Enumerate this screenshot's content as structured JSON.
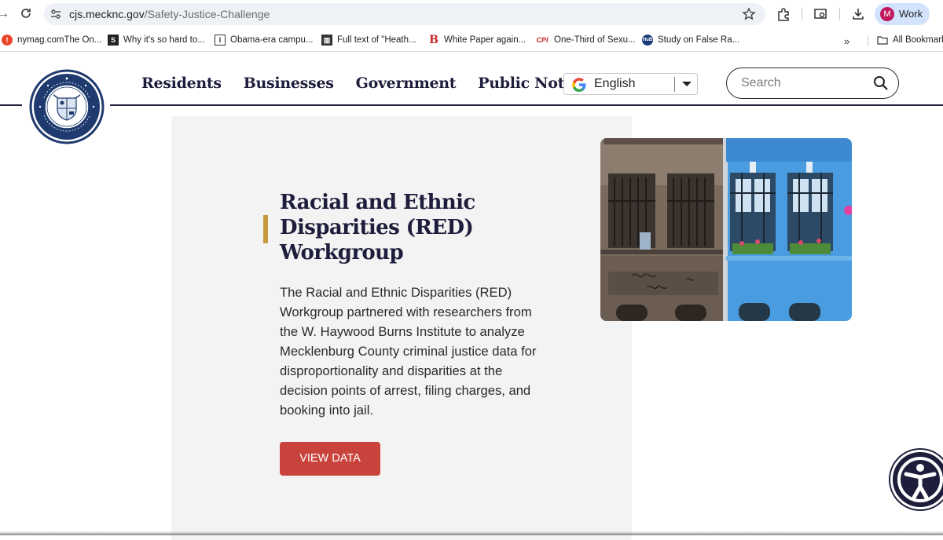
{
  "browser": {
    "url_host": "cjs.mecknc.gov",
    "url_path": "/Safety-Justice-Challenge",
    "profile_initial": "M",
    "profile_name": "Work",
    "bookmarks": [
      {
        "label": "nymag.comThe On...",
        "icon": "nymag-icon"
      },
      {
        "label": "Why it's so hard to...",
        "icon": "slate-icon"
      },
      {
        "label": "Obama-era campu...",
        "icon": "bookmark-site-icon"
      },
      {
        "label": "Full text of \"Heath...",
        "icon": "archive-icon"
      },
      {
        "label": "White Paper again...",
        "icon": "b-icon"
      },
      {
        "label": "One-Third of Sexu...",
        "icon": "cpi-icon"
      },
      {
        "label": "Study on False Ra...",
        "icon": "hub-icon"
      }
    ],
    "bookmarks_overflow": "»",
    "all_bookmarks": "All Bookmarks"
  },
  "site": {
    "nav": [
      "Residents",
      "Businesses",
      "Government",
      "Public Notices"
    ],
    "language": "English",
    "search_placeholder": "Search"
  },
  "card": {
    "title": "Racial and Ethnic Disparities (RED) Workgroup",
    "description": "The Racial and Ethnic Disparities (RED) Workgroup partnered with researchers from the W. Haywood Burns Institute to analyze Mecklenburg County criminal justice data for disproportionality and disparities at the decision points of arrest, filing charges, and booking into jail.",
    "button": "VIEW DATA"
  },
  "colors": {
    "navy": "#1e1e3c",
    "accent_gold": "#c49a3a",
    "button_red": "#c9433d",
    "card_bg": "#f3f3f3"
  }
}
